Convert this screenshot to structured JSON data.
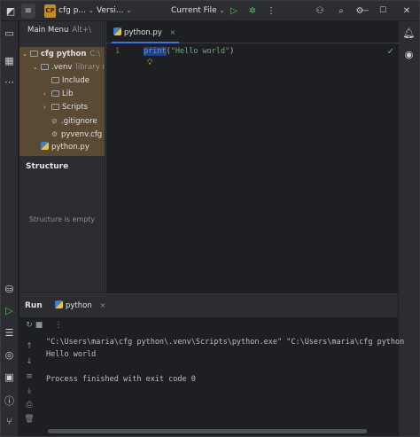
{
  "titlebar": {
    "project_badge": "CP",
    "project_name": "cfg p...",
    "vcs_label": "Versi...",
    "run_config": "Current File"
  },
  "main_menu": {
    "label": "Main Menu",
    "shortcut": "Alt+\\"
  },
  "project_tree": [
    {
      "label": "cfg python",
      "suffix": "C:\\",
      "depth": 0,
      "expanded": true,
      "type": "folder",
      "bold": true
    },
    {
      "label": ".venv",
      "suffix": "library r",
      "depth": 1,
      "expanded": true,
      "type": "folder"
    },
    {
      "label": "Include",
      "depth": 2,
      "type": "folder"
    },
    {
      "label": "Lib",
      "depth": 2,
      "expanded": false,
      "type": "folder"
    },
    {
      "label": "Scripts",
      "depth": 2,
      "expanded": false,
      "type": "folder"
    },
    {
      "label": ".gitignore",
      "depth": 2,
      "type": "gitignore"
    },
    {
      "label": "pyvenv.cfg",
      "depth": 2,
      "type": "config"
    },
    {
      "label": "python.py",
      "depth": 1,
      "type": "python"
    }
  ],
  "structure": {
    "title": "Structure",
    "empty_text": "Structure is empty"
  },
  "editor": {
    "tab_label": "python.py",
    "line_number": "1",
    "code_keyword": "print",
    "code_open": "(",
    "code_string": "\"Hello world\"",
    "code_close": ")"
  },
  "run_panel": {
    "title": "Run",
    "tab_label": "python",
    "console_lines": [
      "\"C:\\Users\\maria\\cfg python\\.venv\\Scripts\\python.exe\" \"C:\\Users\\maria\\cfg python",
      "Hello world",
      "",
      "Process finished with exit code 0"
    ]
  },
  "colors": {
    "accent": "#3574f0",
    "selection": "#214283",
    "tree_highlight": "#5a4a33",
    "run_green": "#5fb865"
  }
}
